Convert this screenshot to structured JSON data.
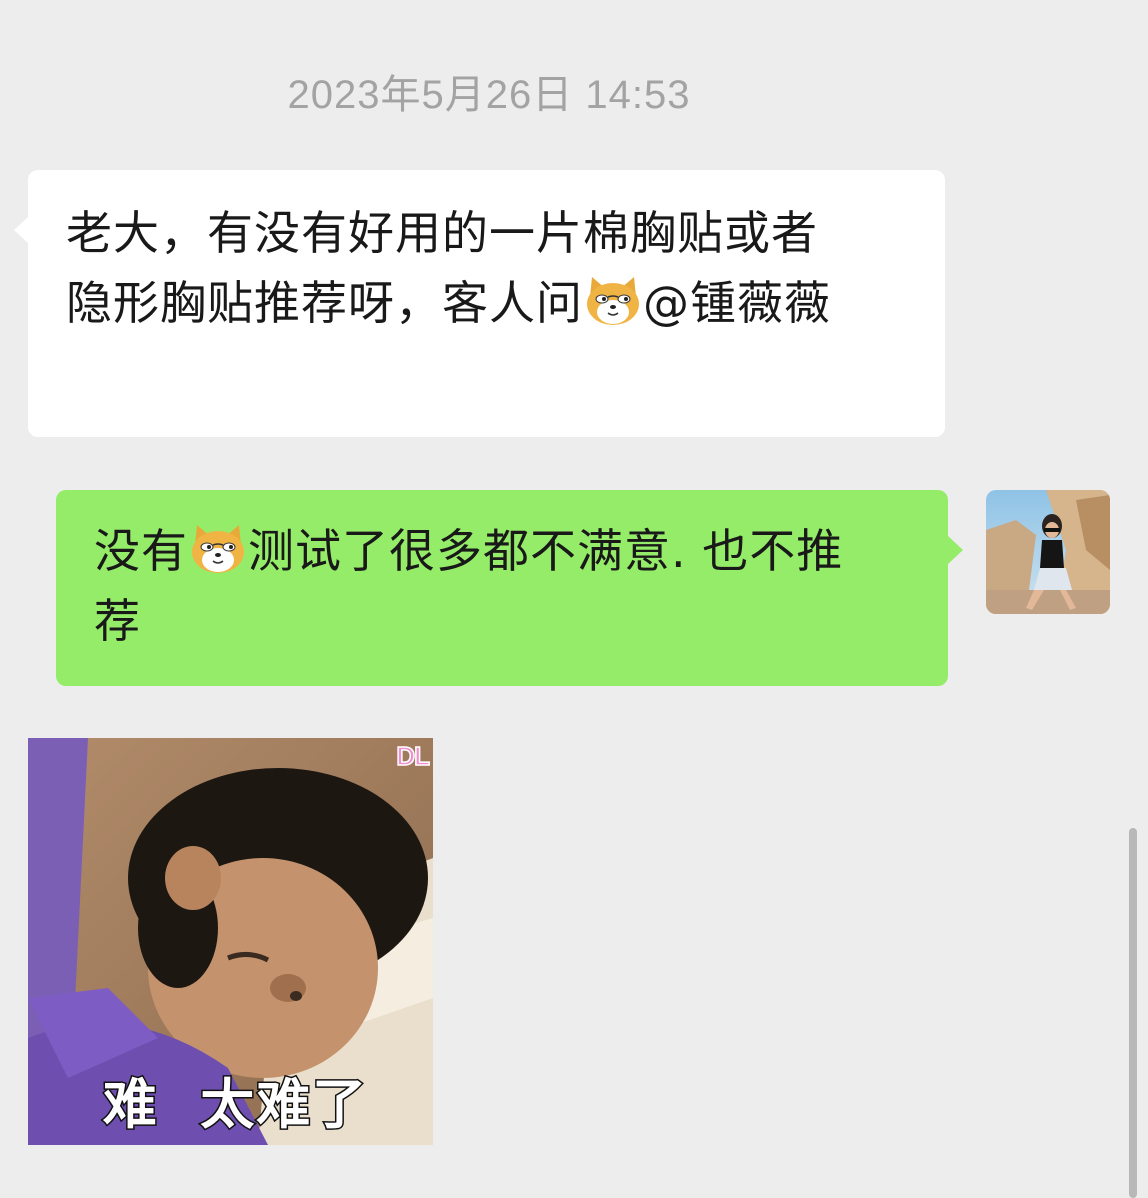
{
  "timestamp": "2023年5月26日 14:53",
  "messages": [
    {
      "side": "in",
      "line1": "老大，有没有好用的一片棉胸贴或者",
      "line2_pre": "隐形胸贴推荐呀，客人问",
      "emoji": "doge-emoji",
      "line2_post": "@锺薇薇"
    },
    {
      "side": "out",
      "text_pre": "没有",
      "emoji": "doge-emoji",
      "text_mid": "测试了很多都不满意. 也不推",
      "text_end": "荐"
    }
  ],
  "sticker": {
    "watermark": "DL",
    "caption": "难  太难了"
  },
  "colors": {
    "background": "#ededed",
    "incoming_bubble": "#ffffff",
    "outgoing_bubble": "#95ec69",
    "timestamp_text": "#a3a3a3"
  }
}
